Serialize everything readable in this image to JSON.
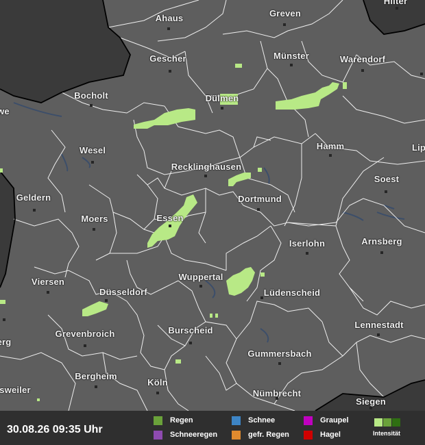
{
  "timestamp": "30.08.26 09:35 Uhr",
  "cities": [
    {
      "id": "hilter",
      "name": "Hilter"
    },
    {
      "id": "ahaus",
      "name": "Ahaus"
    },
    {
      "id": "greven",
      "name": "Greven"
    },
    {
      "id": "gescher",
      "name": "Gescher"
    },
    {
      "id": "muenster",
      "name": "Münster"
    },
    {
      "id": "warendorf",
      "name": "Warendorf"
    },
    {
      "id": "bocholt",
      "name": "Bocholt"
    },
    {
      "id": "duelmen",
      "name": "Dülmen"
    },
    {
      "id": "we",
      "name": "we"
    },
    {
      "id": "wesel",
      "name": "Wesel"
    },
    {
      "id": "hamm",
      "name": "Hamm"
    },
    {
      "id": "lip",
      "name": "Lip"
    },
    {
      "id": "recklinghausen",
      "name": "Recklinghausen"
    },
    {
      "id": "soest",
      "name": "Soest"
    },
    {
      "id": "geldern",
      "name": "Geldern"
    },
    {
      "id": "dortmund",
      "name": "Dortmund"
    },
    {
      "id": "moers",
      "name": "Moers"
    },
    {
      "id": "essen",
      "name": "Essen"
    },
    {
      "id": "iserlohn",
      "name": "Iserlohn"
    },
    {
      "id": "arnsberg",
      "name": "Arnsberg"
    },
    {
      "id": "viersen",
      "name": "Viersen"
    },
    {
      "id": "wuppertal",
      "name": "Wuppertal"
    },
    {
      "id": "duesseldorf",
      "name": "Düsseldorf"
    },
    {
      "id": "luedenscheid",
      "name": "Lüdenscheid"
    },
    {
      "id": "lennestadt",
      "name": "Lennestadt"
    },
    {
      "id": "erg",
      "name": "erg"
    },
    {
      "id": "grevenbroich",
      "name": "Grevenbroich"
    },
    {
      "id": "burscheid",
      "name": "Burscheid"
    },
    {
      "id": "gummersbach",
      "name": "Gummersbach"
    },
    {
      "id": "bergheim",
      "name": "Bergheim"
    },
    {
      "id": "koeln",
      "name": "Köln"
    },
    {
      "id": "sweiler",
      "name": "sweiler"
    },
    {
      "id": "nuembrecht",
      "name": "Nümbrecht"
    },
    {
      "id": "siegen",
      "name": "Siegen"
    }
  ],
  "legend": {
    "regen": "Regen",
    "schneeregen": "Schneeregen",
    "schnee": "Schnee",
    "gefr_regen": "gefr. Regen",
    "graupel": "Graupel",
    "hagel": "Hagel",
    "intensitaet": "Intensität"
  },
  "colors": {
    "background": "#5e5e5e",
    "outside_country": "#3a3a3a",
    "borders": "#ffffff",
    "rain_light": "#b8e986",
    "regen": "#6aa23a",
    "schneeregen": "#8e4bb0",
    "schnee": "#3d85c6",
    "gefr_regen": "#e08a2e",
    "graupel": "#c000c0",
    "hagel": "#d00000",
    "intensity": [
      "#b8e986",
      "#6aa23a",
      "#2f6f12"
    ]
  }
}
